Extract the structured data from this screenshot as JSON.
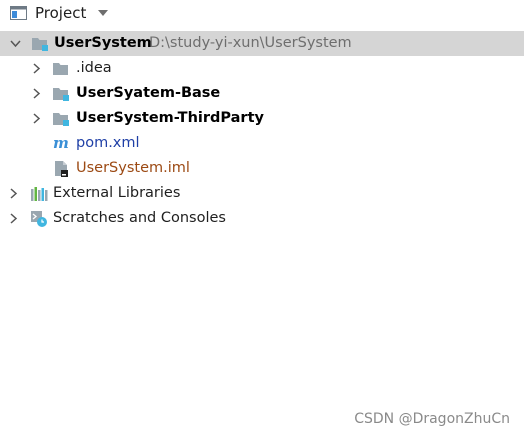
{
  "header": {
    "title": "Project",
    "icon": "project-window-icon",
    "dropdown_icon": "chevron-down-icon"
  },
  "tree": {
    "root": {
      "name": "UserSystem",
      "path": "D:\\study-yi-xun\\UserSystem",
      "icon": "module-folder-icon",
      "expanded": true
    },
    "items": [
      {
        "label": ".idea",
        "icon": "folder-icon",
        "style": "normal",
        "expandable": true
      },
      {
        "label": "UserSyatem-Base",
        "icon": "module-folder-icon",
        "style": "bold",
        "expandable": true
      },
      {
        "label": "UserSystem-ThirdParty",
        "icon": "module-folder-icon",
        "style": "bold",
        "expandable": true
      },
      {
        "label": "pom.xml",
        "icon": "maven-icon",
        "style": "blue",
        "expandable": false
      },
      {
        "label": "UserSystem.iml",
        "icon": "iml-file-icon",
        "style": "brown",
        "expandable": false
      }
    ],
    "external_libraries": {
      "label": "External Libraries",
      "icon": "libraries-icon"
    },
    "scratches": {
      "label": "Scratches and Consoles",
      "icon": "scratches-icon"
    }
  },
  "watermark": "CSDN @DragonZhuCn",
  "colors": {
    "selected_row": "#d5d5d5",
    "folder": "#9aa7b0",
    "module_badge": "#40b6e0",
    "maven_blue": "#1f3fa6",
    "iml_brown": "#9c4a14"
  }
}
